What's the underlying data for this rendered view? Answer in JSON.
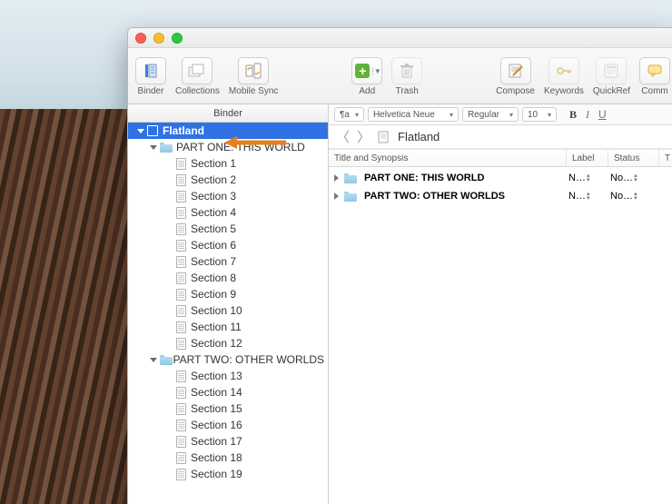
{
  "toolbar": {
    "binder": "Binder",
    "collections": "Collections",
    "mobile_sync": "Mobile Sync",
    "add": "Add",
    "trash": "Trash",
    "compose": "Compose",
    "keywords": "Keywords",
    "quickref": "QuickRef",
    "comm": "Comm"
  },
  "sidebar": {
    "header": "Binder",
    "root": "Flatland",
    "part1": "PART ONE: THIS WORLD",
    "part2": "PART TWO: OTHER WORLDS",
    "sections": [
      "Section 1",
      "Section 2",
      "Section 3",
      "Section 4",
      "Section 5",
      "Section 6",
      "Section 7",
      "Section 8",
      "Section 9",
      "Section 10",
      "Section 11",
      "Section 12",
      "Section 13",
      "Section 14",
      "Section 15",
      "Section 16",
      "Section 17",
      "Section 18",
      "Section 19"
    ]
  },
  "format": {
    "para_icon": "¶a",
    "font": "Helvetica Neue",
    "style": "Regular",
    "size": "10",
    "bold": "B",
    "italic": "I",
    "underline": "U"
  },
  "location": {
    "title": "Flatland"
  },
  "columns": {
    "ts": "Title and Synopsis",
    "label": "Label",
    "status": "Status",
    "t": "T"
  },
  "outline": {
    "rows": [
      {
        "title": "PART ONE: THIS WORLD",
        "label": "N…",
        "status": "No…"
      },
      {
        "title": "PART TWO: OTHER WORLDS",
        "label": "N…",
        "status": "No…"
      }
    ]
  }
}
